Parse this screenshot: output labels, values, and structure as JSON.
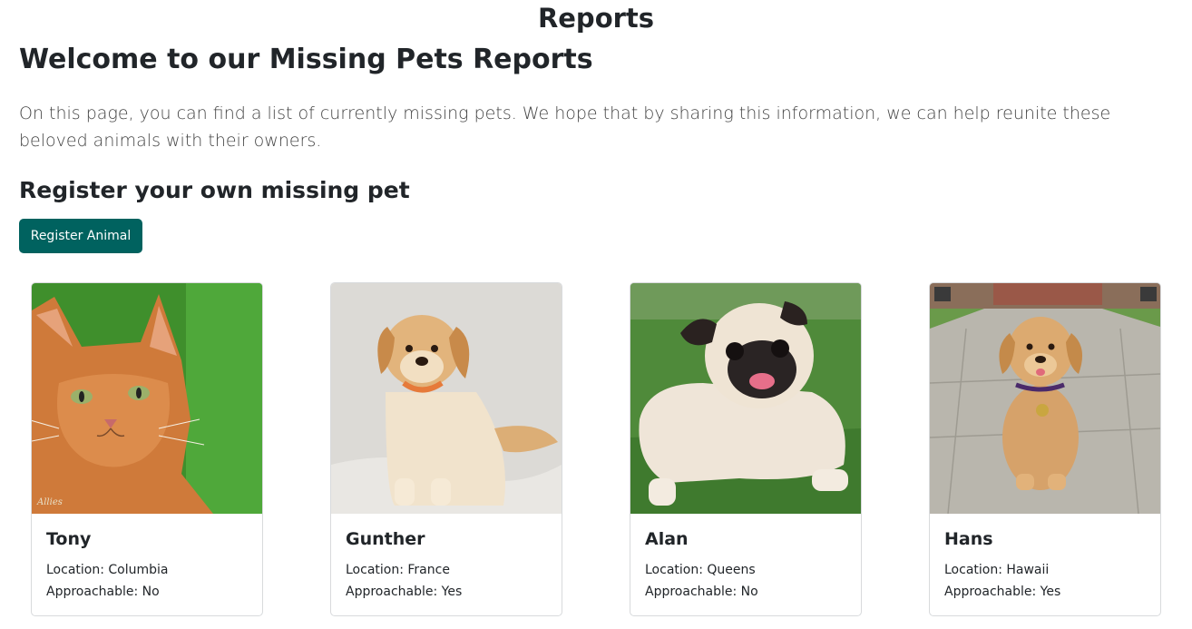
{
  "header": {
    "title": "Reports"
  },
  "welcome": {
    "heading": "Welcome to our Missing Pets Reports",
    "intro": "On this page, you can find a list of currently missing pets. We hope that by sharing this information, we can help reunite these beloved animals with their owners."
  },
  "register": {
    "heading": "Register your own missing pet",
    "button_label": "Register Animal",
    "button_color": "#00625f"
  },
  "pets": [
    {
      "name": "Tony",
      "location": "Location: Columbia",
      "approachable": "Approachable: No",
      "watermark": "Allies"
    },
    {
      "name": "Gunther",
      "location": "Location: France",
      "approachable": "Approachable: Yes"
    },
    {
      "name": "Alan",
      "location": "Location: Queens",
      "approachable": "Approachable: No"
    },
    {
      "name": "Hans",
      "location": "Location: Hawaii",
      "approachable": "Approachable: Yes"
    }
  ]
}
